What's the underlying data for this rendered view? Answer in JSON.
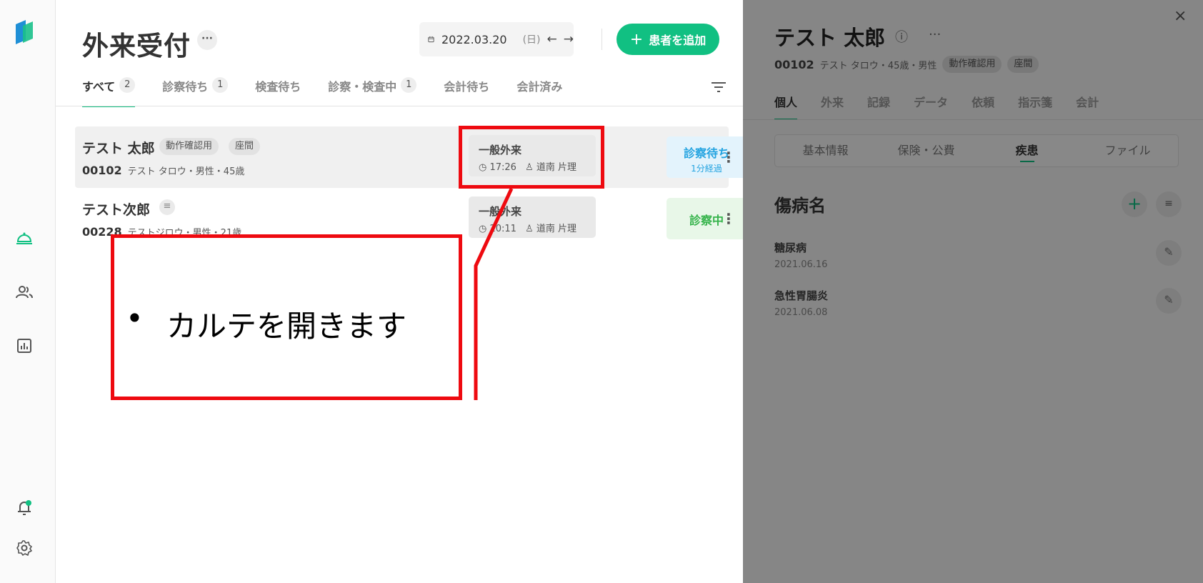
{
  "header": {
    "title": "外来受付",
    "more_label": "···",
    "date": "2022.03.20",
    "weekday": "(日)",
    "add_button": "患者を追加"
  },
  "tabs": [
    {
      "label": "すべて",
      "count": "2"
    },
    {
      "label": "診察待ち",
      "count": "1"
    },
    {
      "label": "検査待ち",
      "count": ""
    },
    {
      "label": "診察・検査中",
      "count": "1"
    },
    {
      "label": "会計待ち",
      "count": ""
    },
    {
      "label": "会計済み",
      "count": ""
    }
  ],
  "patients": [
    {
      "name": "テスト 太郎",
      "tags": [
        "動作確認用",
        "座間"
      ],
      "id": "00102",
      "info": "テスト タロウ・男性・45歳",
      "visit_type": "一般外来",
      "time": "17:26",
      "doctor": "道南 片理",
      "status": "診察待ち",
      "status_sub": "1分経過"
    },
    {
      "name": "テスト次郎",
      "id": "00228",
      "info": "テストジロウ・男性・21歳",
      "visit_type": "一般外来",
      "time": "20:11",
      "doctor": "道南 片理",
      "status": "診察中"
    }
  ],
  "callout": {
    "bullet": "•",
    "text": "カルテを開きます"
  },
  "panel": {
    "close": "×",
    "name": "テスト 太郎",
    "id": "00102",
    "info": "テスト タロウ・45歳・男性",
    "tags": [
      "動作確認用",
      "座間"
    ],
    "tabs": [
      "個人",
      "外来",
      "記録",
      "データ",
      "依頼",
      "指示箋",
      "会計"
    ],
    "segments": [
      "基本情報",
      "保険・公費",
      "疾患",
      "ファイル"
    ],
    "section_title": "傷病名",
    "diseases": [
      {
        "name": "糖尿病",
        "date": "2021.06.16"
      },
      {
        "name": "急性胃腸炎",
        "date": "2021.06.08"
      }
    ]
  },
  "colors": {
    "accent": "#11c082",
    "callout": "#ee0a10",
    "waiting": "#23a3e0",
    "in_progress": "#34b34a"
  }
}
